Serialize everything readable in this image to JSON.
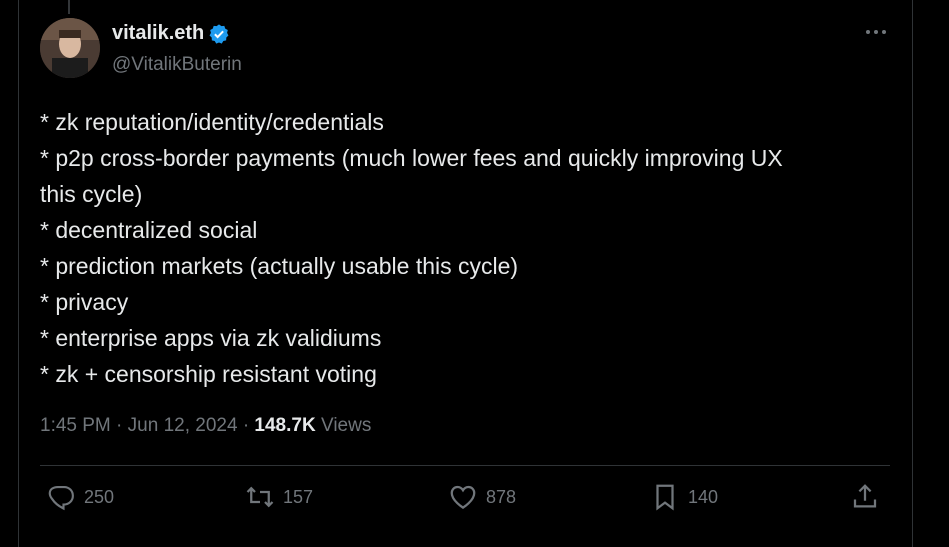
{
  "tweet": {
    "author_name": "vitalik.eth",
    "author_handle": "@VitalikButerin",
    "lines": [
      "* zk reputation/identity/credentials",
      "* p2p cross-border payments (much lower fees and quickly improving UX",
      "this cycle)",
      "* decentralized social",
      "* prediction markets (actually usable this cycle)",
      "* privacy",
      "* enterprise apps via zk validiums",
      "* zk + censorship resistant voting"
    ],
    "time": "1:45 PM",
    "separator": "·",
    "date": "Jun 12, 2024",
    "views_count": "148.7K",
    "views_label": "Views"
  },
  "actions": {
    "replies": "250",
    "reposts": "157",
    "likes": "878",
    "bookmarks": "140"
  },
  "icons": {
    "verified": "verified-badge-icon",
    "more": "more-options-icon",
    "reply": "reply-icon",
    "repost": "repost-icon",
    "like": "like-icon",
    "bookmark": "bookmark-icon",
    "share": "share-icon"
  },
  "colors": {
    "background": "#000000",
    "text": "#e7e9ea",
    "muted": "#71767b",
    "verified": "#1d9bf0",
    "divider": "#2f3336"
  }
}
